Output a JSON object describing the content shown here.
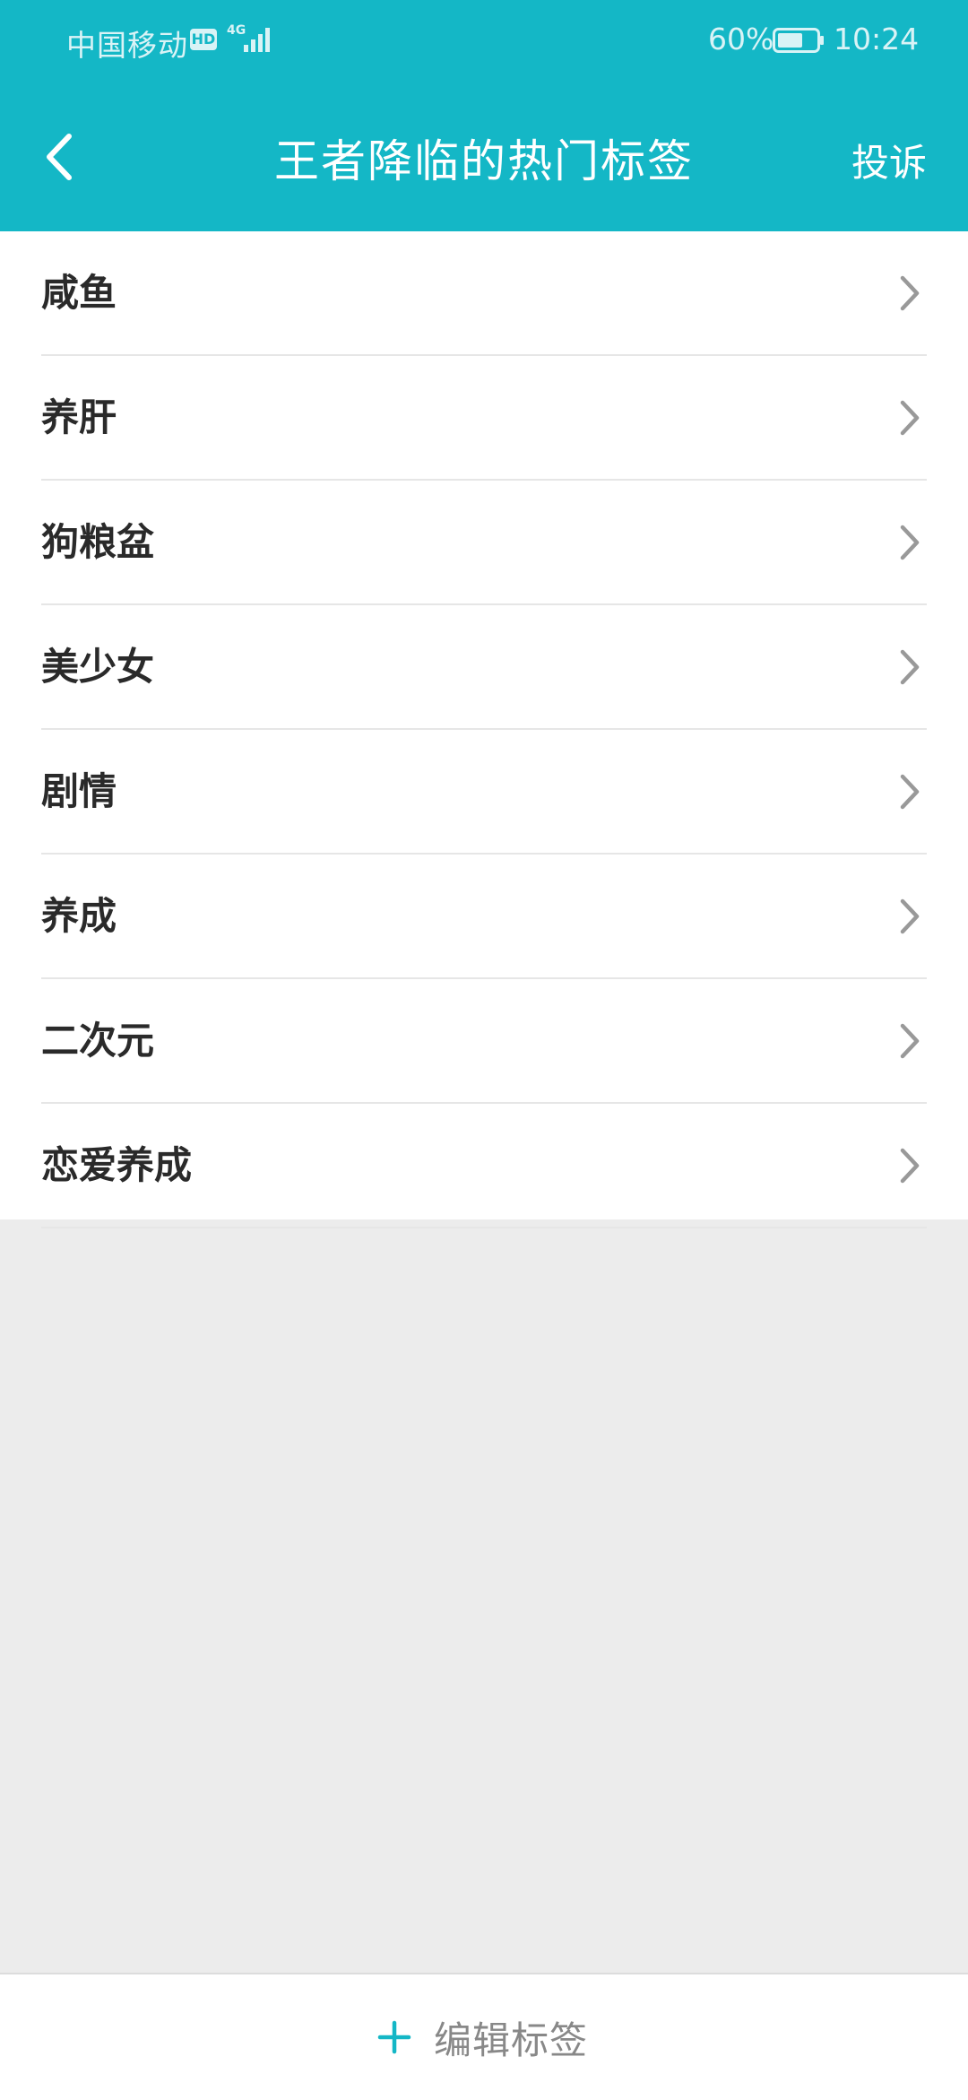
{
  "status_bar": {
    "carrier": "中国移动",
    "hd": "HD",
    "network": "4G",
    "battery": "60%",
    "time": "10:24"
  },
  "header": {
    "title": "王者降临的热门标签",
    "report_label": "投诉",
    "background_color": "#14b7c6"
  },
  "tags": [
    {
      "label": "咸鱼"
    },
    {
      "label": "养肝"
    },
    {
      "label": "狗粮盆"
    },
    {
      "label": "美少女"
    },
    {
      "label": "剧情"
    },
    {
      "label": "养成"
    },
    {
      "label": "二次元"
    },
    {
      "label": "恋爱养成"
    }
  ],
  "bottom": {
    "edit_label": "编辑标签",
    "accent_color": "#14b7c6"
  }
}
